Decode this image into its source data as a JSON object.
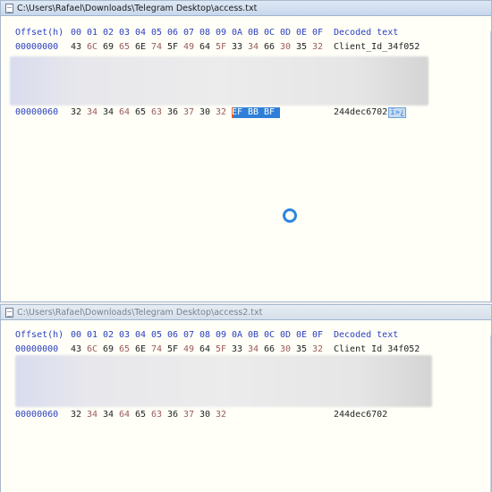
{
  "windows": [
    {
      "title": "C:\\Users\\Rafael\\Downloads\\Telegram Desktop\\access.txt",
      "header": {
        "offset": "Offset(h)",
        "bytes": [
          "00",
          "01",
          "02",
          "03",
          "04",
          "05",
          "06",
          "07",
          "08",
          "09",
          "0A",
          "0B",
          "0C",
          "0D",
          "0E",
          "0F"
        ],
        "decoded": "Decoded text"
      },
      "rows": [
        {
          "offset": "00000000",
          "bytes": [
            "43",
            "6C",
            "69",
            "65",
            "6E",
            "74",
            "5F",
            "49",
            "64",
            "5F",
            "33",
            "34",
            "66",
            "30",
            "35",
            "32"
          ],
          "decoded": "Client_Id_34f052"
        },
        {
          "offset": "00000060",
          "bytes": [
            "32",
            "34",
            "34",
            "64",
            "65",
            "63",
            "36",
            "37",
            "30",
            "32",
            "EF",
            "BB",
            "BF",
            "",
            "",
            ""
          ],
          "decoded": "244dec6702",
          "decoded_selected": "ï»¿"
        }
      ],
      "selected_bytes": [
        "EF",
        "BB",
        "BF"
      ]
    },
    {
      "title": "C:\\Users\\Rafael\\Downloads\\Telegram Desktop\\access2.txt",
      "header": {
        "offset": "Offset(h)",
        "bytes": [
          "00",
          "01",
          "02",
          "03",
          "04",
          "05",
          "06",
          "07",
          "08",
          "09",
          "0A",
          "0B",
          "0C",
          "0D",
          "0E",
          "0F"
        ],
        "decoded": "Decoded text"
      },
      "rows": [
        {
          "offset": "00000000",
          "bytes": [
            "43",
            "6C",
            "69",
            "65",
            "6E",
            "74",
            "5F",
            "49",
            "64",
            "5F",
            "33",
            "34",
            "66",
            "30",
            "35",
            "32"
          ],
          "decoded": "Client Id 34f052"
        },
        {
          "offset": "00000060",
          "bytes": [
            "32",
            "34",
            "34",
            "64",
            "65",
            "63",
            "36",
            "37",
            "30",
            "32",
            "",
            "",
            "",
            "",
            "",
            ""
          ],
          "decoded": "244dec6702"
        }
      ]
    }
  ],
  "icons": {
    "window_icon": "document-icon",
    "loading_indicator": "loading-spinner-icon"
  },
  "colors": {
    "offset_blue": "#2b3fbf",
    "alt_byte": "#9c5a5a",
    "selection": "#2f7fd8",
    "background": "#fffff8"
  }
}
